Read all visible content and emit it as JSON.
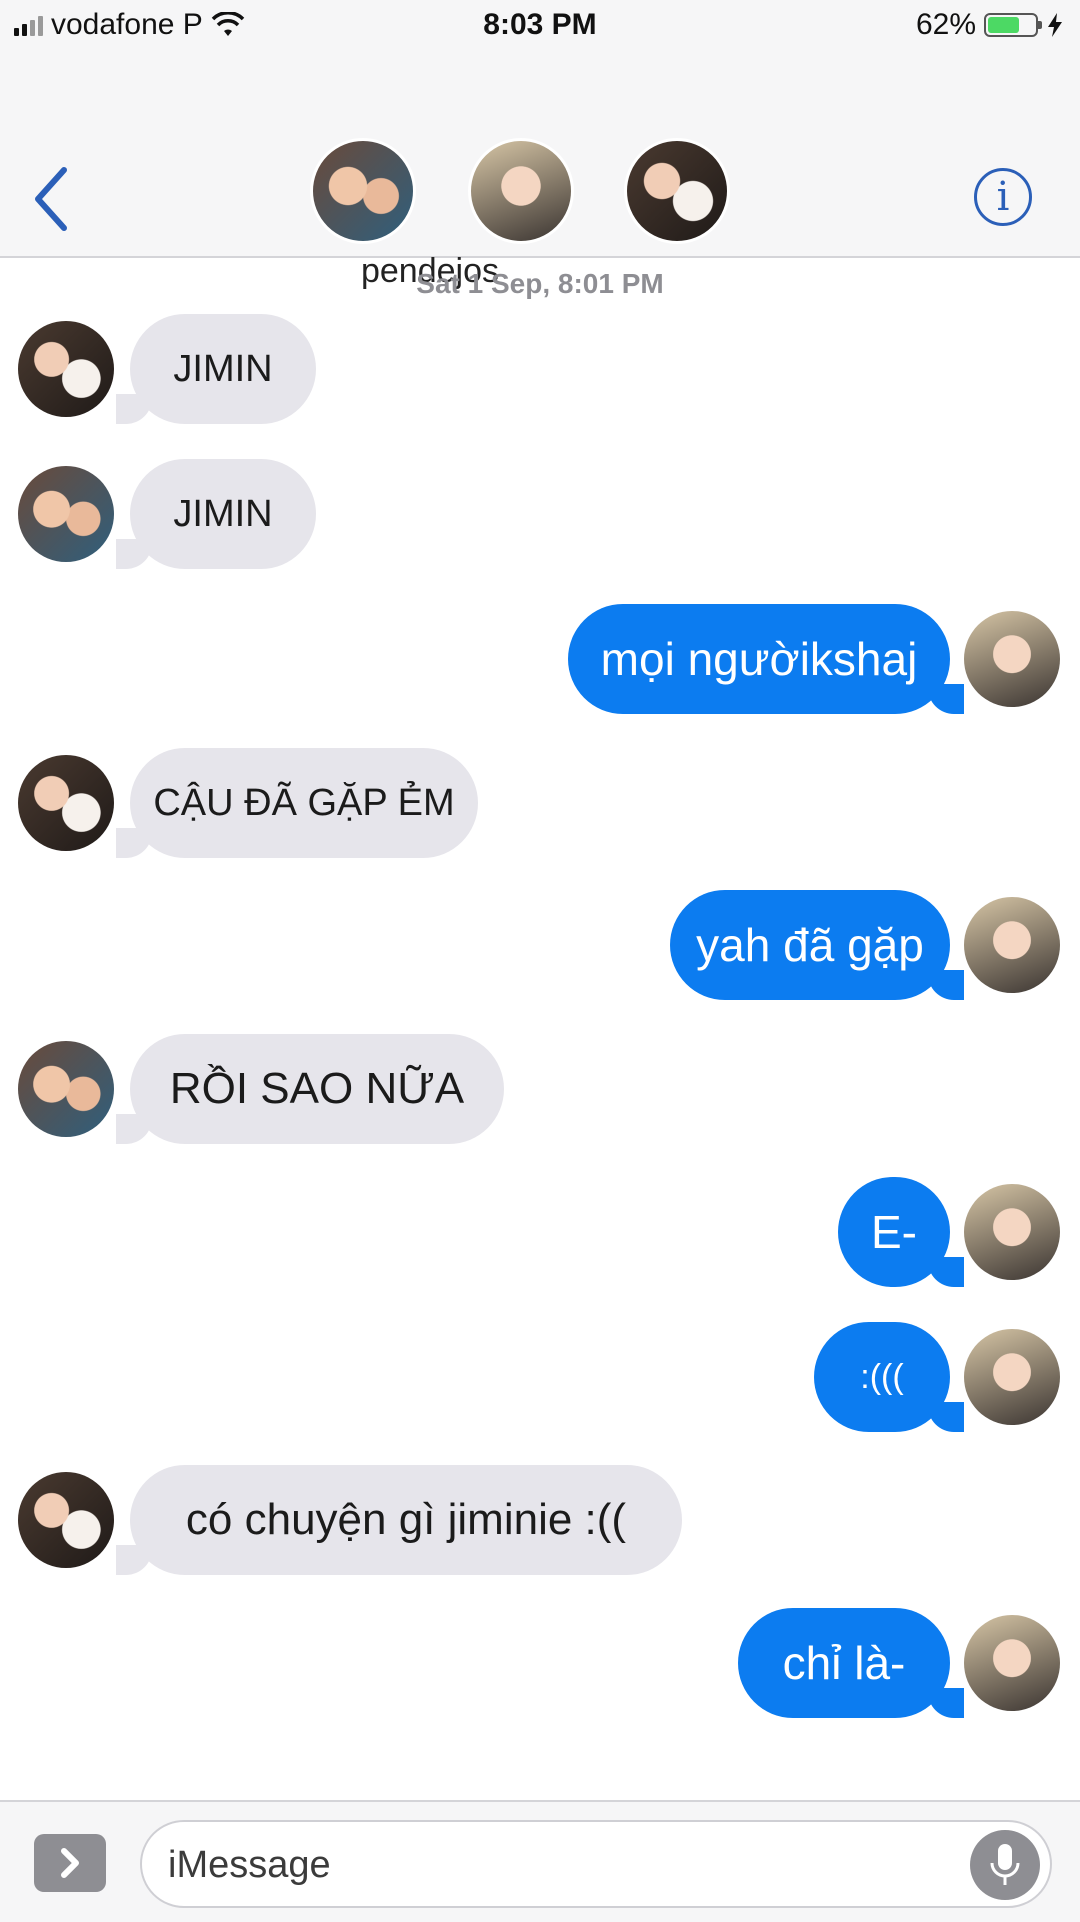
{
  "status_bar": {
    "carrier": "vodafone P",
    "time": "8:03 PM",
    "battery_percent": "62%",
    "battery_level": 0.62,
    "icons": [
      "signal-icon",
      "wifi-icon",
      "battery-icon",
      "charging-icon"
    ]
  },
  "nav": {
    "group_name": "pendejos",
    "back_icon": "chevron-left-icon",
    "info_glyph": "i",
    "accent_color": "#2b5fb8"
  },
  "conversation": {
    "timestamp": "Sat 1 Sep, 8:01 PM",
    "messages": [
      {
        "direction": "incoming",
        "text": "JIMIN"
      },
      {
        "direction": "incoming",
        "text": "JIMIN"
      },
      {
        "direction": "outgoing",
        "text": "mọi ngườikshaj"
      },
      {
        "direction": "incoming",
        "text": "CẬU ĐÃ GẶP ẺM"
      },
      {
        "direction": "outgoing",
        "text": "yah đã gặp"
      },
      {
        "direction": "incoming",
        "text": "RỒI SAO NỮA"
      },
      {
        "direction": "outgoing",
        "text": "E-"
      },
      {
        "direction": "outgoing",
        "text": ":((("
      },
      {
        "direction": "incoming",
        "text": "có chuyện gì jiminie :(("
      },
      {
        "direction": "outgoing",
        "text": "chỉ là-"
      }
    ]
  },
  "composer": {
    "placeholder": "iMessage",
    "apps_icon": "app-store-chevron-icon",
    "mic_icon": "microphone-icon"
  },
  "colors": {
    "outgoing_bubble": "#0c7cf0",
    "incoming_bubble": "#e6e5eb",
    "header_bg": "#f6f6f7",
    "timestamp": "#8e8e93"
  }
}
